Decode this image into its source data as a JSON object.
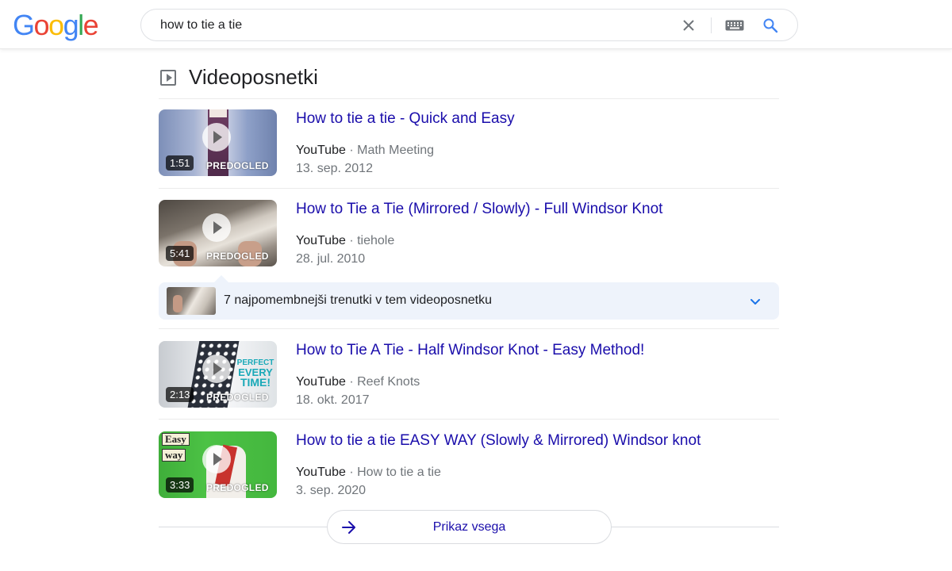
{
  "logo": {
    "letters": [
      "G",
      "o",
      "o",
      "g",
      "l",
      "e"
    ],
    "colors": [
      "#4285f4",
      "#ea4335",
      "#fbbc05",
      "#4285f4",
      "#34a853",
      "#ea4335"
    ]
  },
  "search": {
    "query": "how to tie a tie"
  },
  "section": {
    "title": "Videoposnetki",
    "icon": "video-section-icon"
  },
  "videos": [
    {
      "title": "How to tie a tie - Quick and Easy",
      "source": "YouTube",
      "sep": "·",
      "channel": "Math Meeting",
      "date": "13. sep. 2012",
      "duration": "1:51",
      "watched": "PREDOGLED"
    },
    {
      "title": "How to Tie a Tie (Mirrored / Slowly) - Full Windsor Knot",
      "source": "YouTube",
      "sep": "·",
      "channel": "tiehole",
      "date": "28. jul. 2010",
      "duration": "5:41",
      "watched": "PREDOGLED"
    },
    {
      "title": "How to Tie A Tie - Half Windsor Knot - Easy Method!",
      "source": "YouTube",
      "sep": "·",
      "channel": "Reef Knots",
      "date": "18. okt. 2017",
      "duration": "2:13",
      "watched": "PREDOGLED",
      "thumb_text": [
        "PERFECT",
        "EVERY",
        "TIME!"
      ]
    },
    {
      "title": "How to tie a tie EASY WAY (Slowly & Mirrored) Windsor knot",
      "source": "YouTube",
      "sep": "·",
      "channel": "How to tie a tie",
      "date": "3. sep. 2020",
      "duration": "3:33",
      "watched": "PREDOGLED",
      "thumb_text": [
        "Easy",
        "way"
      ]
    }
  ],
  "key_moments": {
    "label": "7 najpomembnejši trenutki v tem videoposnetku"
  },
  "show_all": {
    "label": "Prikaz vsega"
  },
  "colors": {
    "link": "#1a0dab",
    "moments_bg": "#eef3fb"
  }
}
